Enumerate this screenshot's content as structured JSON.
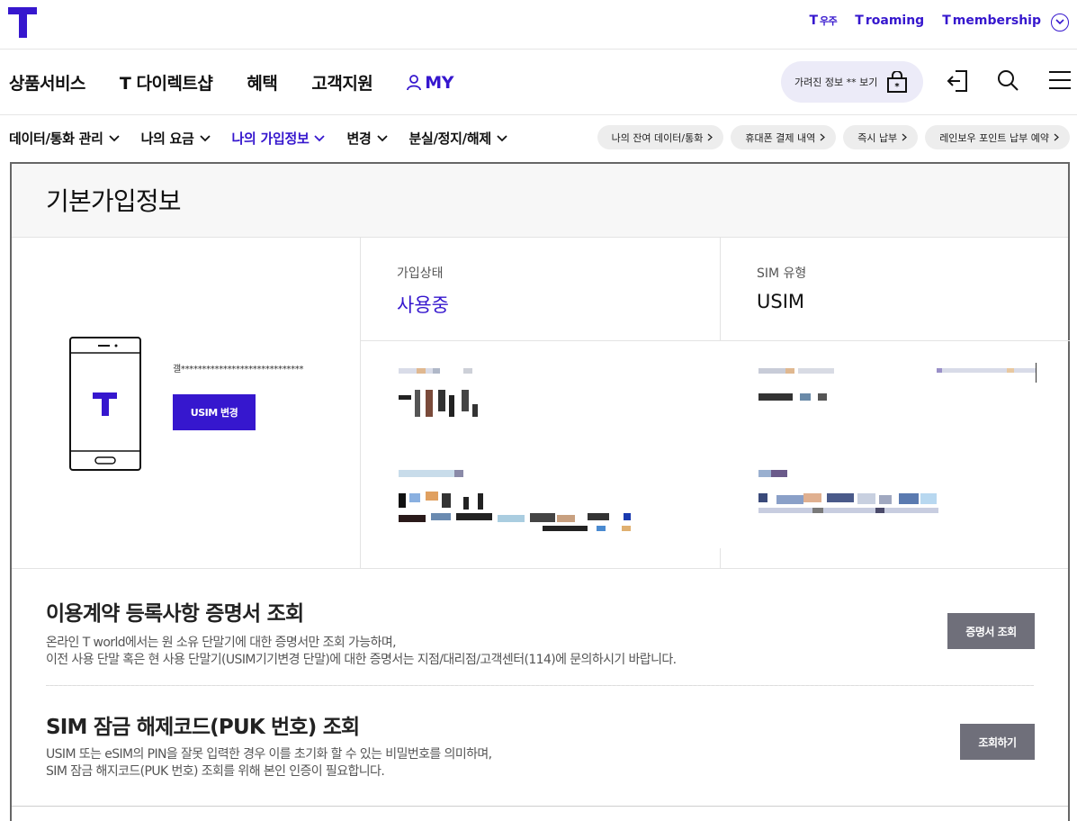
{
  "brand": {
    "accent": "#3617ce"
  },
  "top_links": [
    {
      "t": "T",
      "label": "우주"
    },
    {
      "t": "T",
      "label": "roaming"
    },
    {
      "t": "T",
      "label": "membership"
    }
  ],
  "main_nav": {
    "items": [
      "상품서비스",
      "T 다이렉트샵",
      "혜택",
      "고객지원"
    ],
    "my_label": "MY",
    "hidden_info_label": "가려진 정보 ** 보기"
  },
  "sub_nav": {
    "items": [
      {
        "label": "데이터/통화 관리",
        "active": false
      },
      {
        "label": "나의 요금",
        "active": false
      },
      {
        "label": "나의 가입정보",
        "active": true
      },
      {
        "label": "변경",
        "active": false
      },
      {
        "label": "분실/정지/해제",
        "active": false
      }
    ],
    "chips": [
      "나의 잔여 데이터/통화",
      "휴대폰 결제 내역",
      "즉시 납부",
      "레인보우 포인트 납부 예약"
    ]
  },
  "page": {
    "title": "기본가입정보",
    "masked_name": "갤*****************************",
    "usim_button": "USIM 변경",
    "status_label": "가입상태",
    "status_value": "사용중",
    "sim_label": "SIM 유형",
    "sim_value": "USIM"
  },
  "sections": [
    {
      "title": "이용계약 등록사항 증명서 조회",
      "desc1": "온라인 T world에서는 원 소유 단말기에 대한 증명서만 조회 가능하며,",
      "desc2": "이전 사용 단말 혹은 현 사용 단말기(USIM기기변경 단말)에 대한 증명서는 지점/대리점/고객센터(114)에 문의하시기 바랍니다.",
      "button": "증명서 조회"
    },
    {
      "title": "SIM 잠금 해제코드(PUK 번호) 조회",
      "desc1": "USIM 또는 eSIM의 PIN을 잘못 입력한 경우 이를 초기화 할 수 있는 비밀번호를 의미하며,",
      "desc2": "SIM 잠금 해지코드(PUK 번호) 조회를 위해 본인 인증이 필요합니다.",
      "button": "조회하기"
    }
  ]
}
